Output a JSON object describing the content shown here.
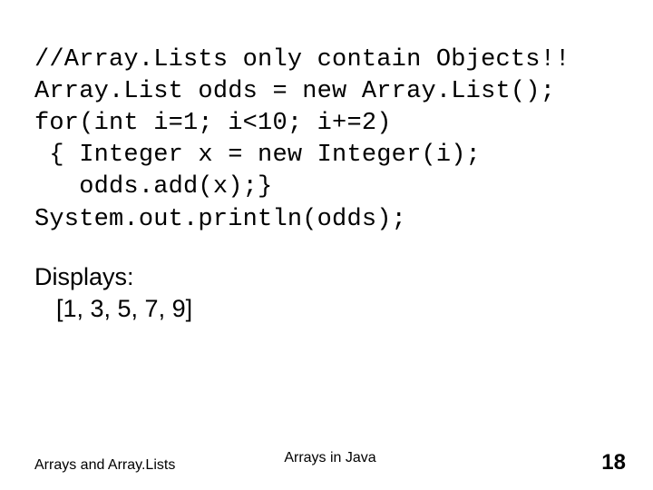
{
  "code": {
    "l1": "//Array.Lists only contain Objects!!",
    "l2": "Array.List odds = new Array.List();",
    "l3": "for(int i=1; i<10; i+=2)",
    "l4": " { Integer x = new Integer(i);",
    "l5": "   odds.add(x);}",
    "l6": "System.out.println(odds);"
  },
  "prose": {
    "label": "Displays:",
    "output": "[1, 3, 5, 7, 9]"
  },
  "footer": {
    "left": "Arrays and Array.Lists",
    "center": "Arrays in Java",
    "page": "18"
  }
}
